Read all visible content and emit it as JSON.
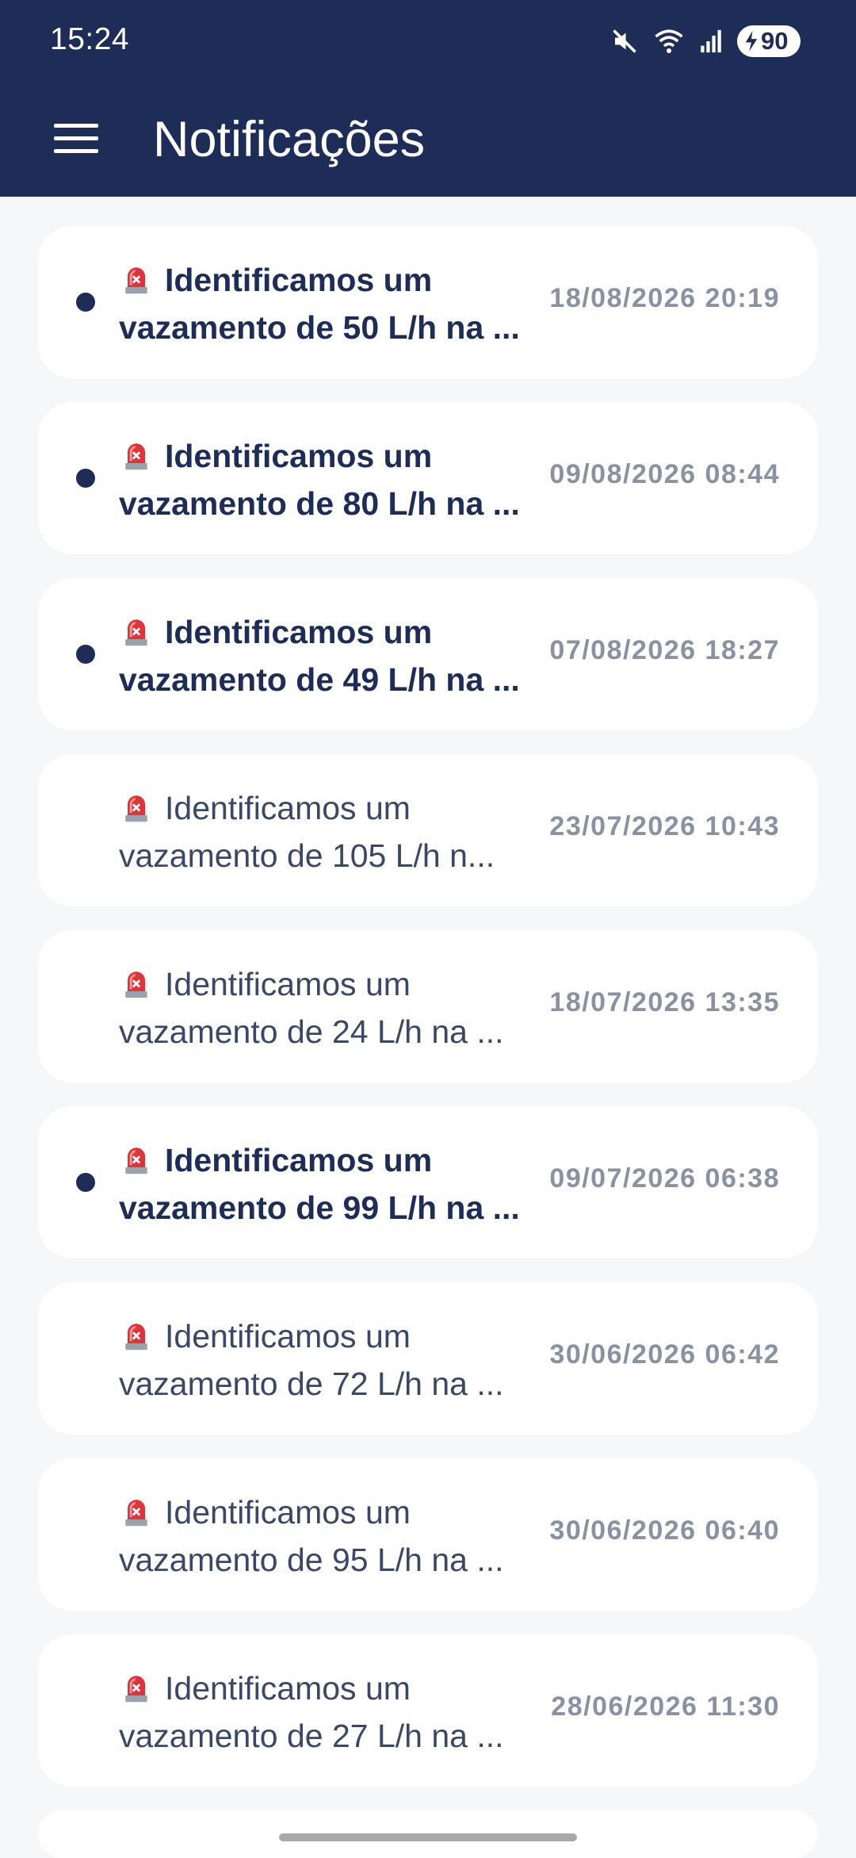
{
  "status_bar": {
    "time": "15:24",
    "battery_level": "90",
    "icons": [
      "mute-icon",
      "wifi-icon",
      "signal-icon",
      "battery-charging-icon"
    ]
  },
  "app_bar": {
    "title": "Notificações",
    "menu_icon": "hamburger-menu-icon"
  },
  "colors": {
    "header": "#1e2d58",
    "background": "#f6f7f9",
    "card": "#ffffff",
    "unread_dot": "#1e2d58",
    "date_text": "#8a91a1"
  },
  "notifications": [
    {
      "line1": "Identificamos um",
      "line2": "vazamento de 50 L/h na ...",
      "date": "18/08/2026 20:19",
      "unread": true
    },
    {
      "line1": "Identificamos um",
      "line2": "vazamento de 80 L/h na ...",
      "date": "09/08/2026 08:44",
      "unread": true
    },
    {
      "line1": "Identificamos um",
      "line2": "vazamento de 49 L/h na ...",
      "date": "07/08/2026 18:27",
      "unread": true
    },
    {
      "line1": "Identificamos um",
      "line2": "vazamento de 105 L/h n...",
      "date": "23/07/2026 10:43",
      "unread": false
    },
    {
      "line1": "Identificamos um",
      "line2": "vazamento de 24 L/h na ...",
      "date": "18/07/2026 13:35",
      "unread": false
    },
    {
      "line1": "Identificamos um",
      "line2": "vazamento de 99 L/h na ...",
      "date": "09/07/2026 06:38",
      "unread": true
    },
    {
      "line1": "Identificamos um",
      "line2": "vazamento de 72 L/h na ...",
      "date": "30/06/2026 06:42",
      "unread": false
    },
    {
      "line1": "Identificamos um",
      "line2": "vazamento de 95 L/h na ...",
      "date": "30/06/2026 06:40",
      "unread": false
    },
    {
      "line1": "Identificamos um",
      "line2": "vazamento de 27 L/h na ...",
      "date": "28/06/2026 11:30",
      "unread": false
    }
  ]
}
